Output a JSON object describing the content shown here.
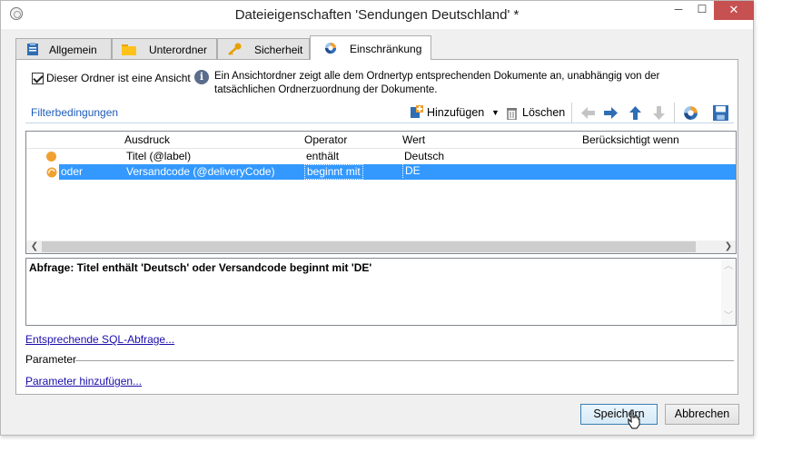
{
  "window": {
    "title": "Dateieigenschaften 'Sendungen Deutschland' *",
    "minimize": "─",
    "maximize": "☐",
    "close": "✕"
  },
  "tabs": [
    {
      "label": "Allgemein",
      "icon": "clipboard-icon"
    },
    {
      "label": "Unterordner",
      "icon": "folder-icon"
    },
    {
      "label": "Sicherheit",
      "icon": "key-icon"
    },
    {
      "label": "Einschränkung",
      "icon": "chart-icon",
      "active": true
    }
  ],
  "view": {
    "checkbox_label": "Dieser Ordner ist eine Ansicht",
    "checked": true,
    "info_line1": "Ein Ansichtordner zeigt alle dem Ordnertyp entsprechenden Dokumente an, unabhängig von der",
    "info_line2": "tatsächlichen Ordnerzuordnung der Dokumente."
  },
  "filter": {
    "header": "Filterbedingungen",
    "add_label": "Hinzufügen",
    "delete_label": "Löschen"
  },
  "grid": {
    "columns": [
      "Ausdruck",
      "Operator",
      "Wert",
      "Berücksichtigt wenn"
    ],
    "rows": [
      {
        "prefix": "",
        "expression": "Titel (@label)",
        "operator": "enthält",
        "value": "Deutsch",
        "condition": "",
        "selected": false
      },
      {
        "prefix": "oder",
        "expression": "Versandcode (@deliveryCode)",
        "operator": "beginnt mit",
        "value": "DE",
        "condition": "",
        "selected": true
      }
    ]
  },
  "query": {
    "text": "Abfrage: Titel enthält 'Deutsch' oder Versandcode beginnt mit 'DE'"
  },
  "links": {
    "sql": "Entsprechende SQL-Abfrage...",
    "parameter_label": "Parameter",
    "add_parameter": "Parameter hinzufügen..."
  },
  "buttons": {
    "save": "Speichern",
    "cancel": "Abbrechen"
  },
  "colors": {
    "selection": "#3399ff",
    "accent_link": "#1f5cb8",
    "close_button": "#c75050",
    "dot": "#f0a030"
  }
}
